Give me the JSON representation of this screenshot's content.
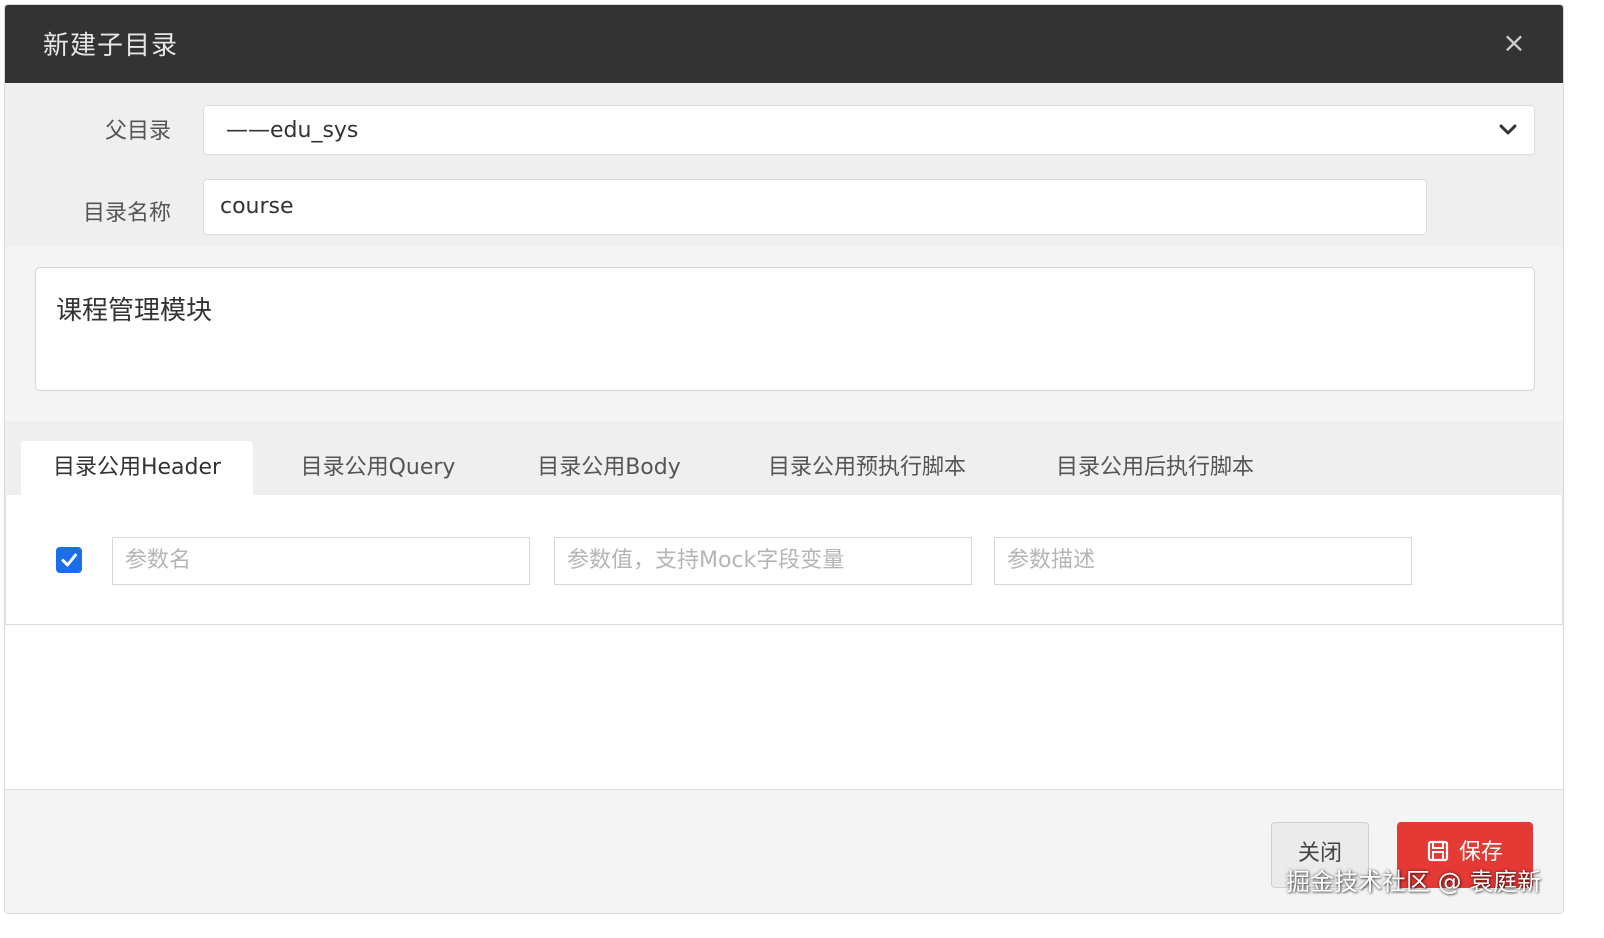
{
  "dialog": {
    "title": "新建子目录",
    "close_icon": "close-icon"
  },
  "form": {
    "parent_label": "父目录",
    "parent_value": "——edu_sys",
    "name_label": "目录名称",
    "name_value": "course",
    "description_value": "课程管理模块"
  },
  "tabs": [
    {
      "label": "目录公用Header",
      "active": true
    },
    {
      "label": "目录公用Query",
      "active": false
    },
    {
      "label": "目录公用Body",
      "active": false
    },
    {
      "label": "目录公用预执行脚本",
      "active": false
    },
    {
      "label": "目录公用后执行脚本",
      "active": false
    }
  ],
  "header_row": {
    "checked": true,
    "name_placeholder": "参数名",
    "value_placeholder": "参数值，支持Mock字段变量",
    "desc_placeholder": "参数描述"
  },
  "footer": {
    "close_label": "关闭",
    "save_label": "保存",
    "save_icon": "save-icon"
  },
  "watermark": "掘金技术社区 @ 袁庭新",
  "colors": {
    "titlebar": "#333333",
    "save_button": "#e53935",
    "checkbox": "#1a6fe8"
  }
}
